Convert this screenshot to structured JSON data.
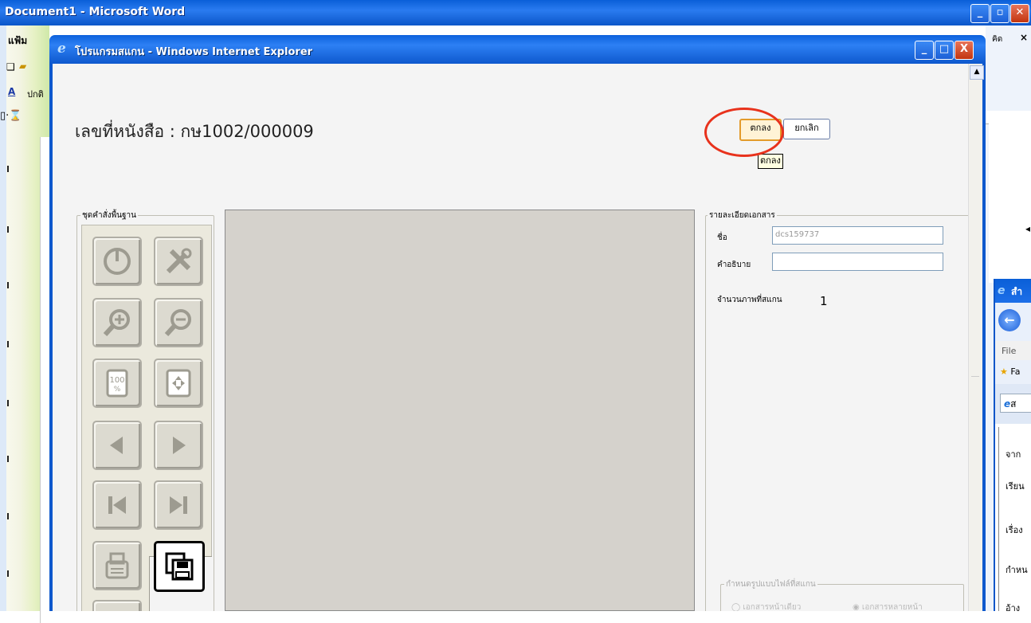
{
  "word": {
    "title": "Document1 - Microsoft Word",
    "menu_label": "แฟ้ม",
    "style_label": "ปกติ",
    "right_menu_label": "คิด",
    "right_close_label": "×"
  },
  "ie": {
    "title": "โปรแกรมสแกน - Windows Internet Explorer",
    "minimize": "_",
    "maximize": "□",
    "close": "X"
  },
  "page": {
    "doc_number": "เลขที่หนังสือ : กษ1002/000009",
    "ok_label": "ตกลง",
    "cancel_label": "ยกเลิก",
    "tooltip": "ตกลง"
  },
  "tools": {
    "legend": "ชุดคำสั่งพื้นฐาน",
    "items": [
      {
        "name": "power-icon"
      },
      {
        "name": "settings-tools-icon"
      },
      {
        "name": "zoom-in-icon"
      },
      {
        "name": "zoom-out-icon"
      },
      {
        "name": "zoom-100-icon",
        "text": "100 %"
      },
      {
        "name": "fit-page-icon"
      },
      {
        "name": "previous-icon"
      },
      {
        "name": "next-icon"
      },
      {
        "name": "first-icon"
      },
      {
        "name": "last-icon"
      },
      {
        "name": "scanner-icon"
      },
      {
        "name": "save-icon"
      },
      {
        "name": "edit-icon"
      }
    ]
  },
  "details": {
    "legend": "รายละเอียดเอกสาร",
    "name_label": "ชื่อ",
    "name_value": "dcs159737",
    "desc_label": "คำอธิบาย",
    "desc_value": "",
    "scan_count_label": "จำนวนภาพที่สแกน",
    "scan_count_value": "1",
    "format_legend": "กำหนดรูปแบบไฟล์ที่สแกน",
    "format_single": "เอกสารหน้าเดียว",
    "format_multi": "เอกสารหลายหน้า"
  },
  "ie2": {
    "title": "สำ",
    "menu": "File",
    "fav": "Fa",
    "tab": "ส",
    "rows": [
      "จาก",
      "เรียน",
      "เรื่อง",
      "กำหน",
      "อ้าง"
    ]
  },
  "colors": {
    "xp_blue": "#0b56c9",
    "highlight_red": "#e8321c",
    "ok_border": "#e39b2b"
  }
}
